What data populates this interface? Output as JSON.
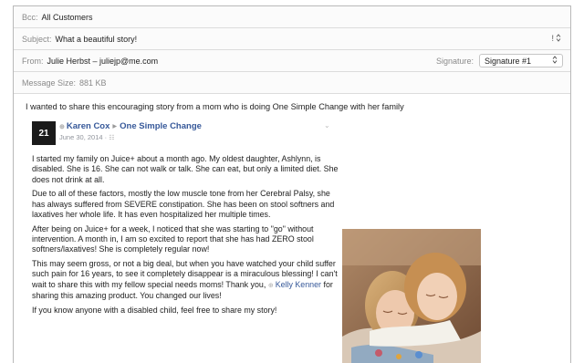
{
  "header": {
    "bcc_label": "Bcc:",
    "bcc_value": "All Customers",
    "subject_label": "Subject:",
    "subject_value": "What a beautiful story!",
    "from_label": "From:",
    "from_value": "Julie Herbst – juliejp@me.com",
    "signature_label": "Signature:",
    "signature_value": "Signature #1",
    "size_label": "Message Size:",
    "size_value": "881 KB"
  },
  "body": {
    "intro": "I wanted to share this encouraging story from a mom who is doing One Simple Change with her family"
  },
  "post": {
    "avatar_text": "21",
    "author": "Karen Cox",
    "arrow": "▸",
    "group": "One Simple Change",
    "date": "June 30, 2014 ·",
    "p1": "I started my family on Juice+ about a month ago. My oldest daughter, Ashlynn, is disabled. She is 16. She can not walk or talk. She can eat, but only a limited diet. She does not drink at all.",
    "p2": "Due to all of these factors, mostly the low muscle tone from her Cerebral Palsy, she has always suffered from SEVERE constipation. She has been on stool softners and laxatives her whole life. It has even hospitalized her multiple times.",
    "p3": "After being on Juice+ for a week, I noticed that she was starting to \"go\" without intervention. A month in, I am so excited to report that she has had ZERO stool softners/laxatives! She is completely regular now!",
    "p4a": "This may seem gross, or not a big deal, but when you have watched your child suffer such pain for 16 years, to see it completely disappear is a miraculous blessing! I can't wait to share this with my fellow special needs moms! Thank you,",
    "mention": "Kelly Kenner",
    "p4b": "for sharing this amazing product. You changed our lives!",
    "p5": "If you know anyone with a disabled child, feel free to share my story!"
  },
  "colors": {
    "link": "#365899",
    "label_gray": "#8a8a8a",
    "border": "#dcdcdc"
  },
  "icons": [
    "priority-icon",
    "stepper-icon",
    "select-arrows-icon",
    "globe-icon",
    "chevron-down-icon",
    "people-icon"
  ]
}
